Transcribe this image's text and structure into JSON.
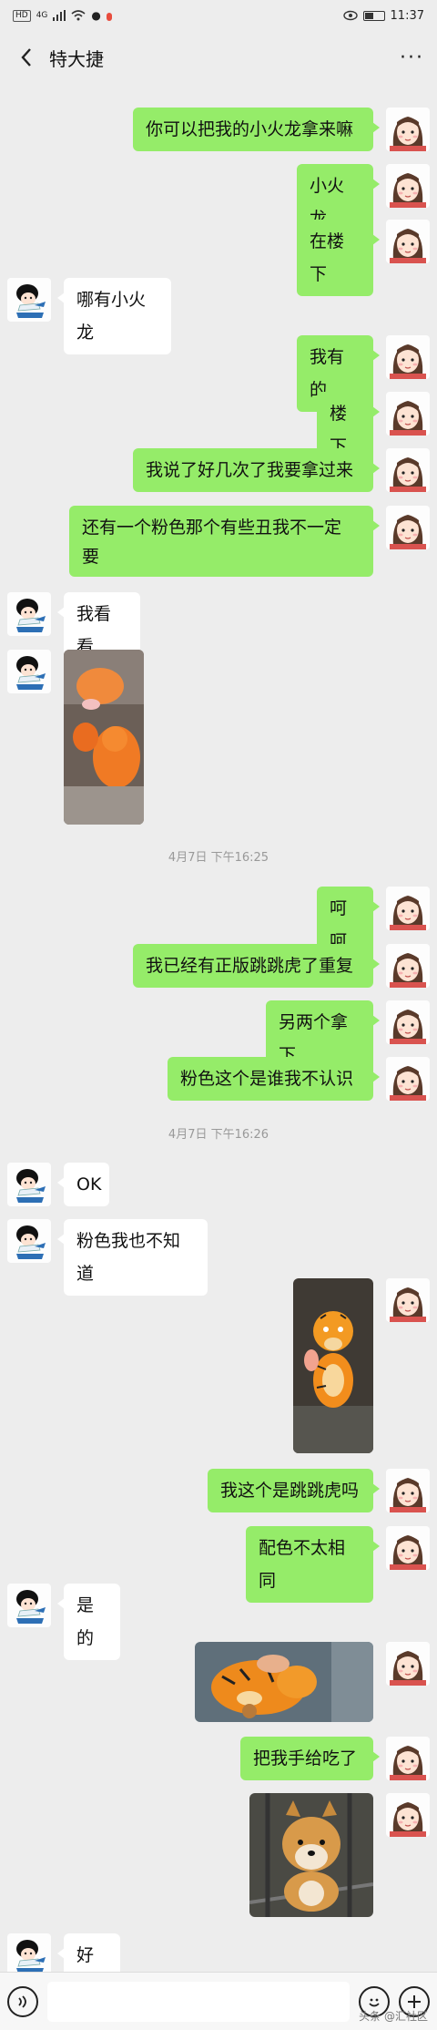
{
  "status_bar": {
    "left_tags": [
      "HD",
      "4G"
    ],
    "notification_badge": "",
    "time": "11:37"
  },
  "chat": {
    "title": "特大捷"
  },
  "messages": [
    {
      "side": "me",
      "text": "你可以把我的小火龙拿来嘛"
    },
    {
      "side": "me",
      "text": "小火龙"
    },
    {
      "side": "me",
      "text": "在楼下"
    },
    {
      "side": "other",
      "text": "哪有小火龙"
    },
    {
      "side": "me",
      "text": "我有的"
    },
    {
      "side": "me",
      "text": "楼下"
    },
    {
      "side": "me",
      "text": "我说了好几次了我要拿过来"
    },
    {
      "side": "me",
      "text_line1": "还有一个粉色那个有些丑我不一定",
      "text_line2": "要"
    },
    {
      "side": "other",
      "text": "我看看"
    },
    {
      "side": "other",
      "image": "photo of orange plush toys (charmander and tigger)"
    },
    {
      "type": "timestamp",
      "text": "4月7日 下午16:25"
    },
    {
      "side": "me",
      "text": "呵呵"
    },
    {
      "side": "me",
      "text": "我已经有正版跳跳虎了重复"
    },
    {
      "side": "me",
      "text": "另两个拿下"
    },
    {
      "side": "me",
      "text": "粉色这个是谁我不认识"
    },
    {
      "type": "timestamp",
      "text": "4月7日 下午16:26"
    },
    {
      "side": "other",
      "text": "OK"
    },
    {
      "side": "other",
      "text": "粉色我也不知道"
    },
    {
      "side": "me",
      "image": "photo of tigger plush toy"
    },
    {
      "side": "me",
      "text": "我这个是跳跳虎吗"
    },
    {
      "side": "me",
      "text": "配色不太相同"
    },
    {
      "side": "other",
      "text": "是的"
    },
    {
      "side": "me",
      "image": "photo of tigger plush lying down"
    },
    {
      "side": "me",
      "text": "把我手给吃了"
    },
    {
      "side": "me",
      "image": "photo of a shiba inu dog"
    },
    {
      "side": "other",
      "text": "好的"
    }
  ],
  "input_bar": {
    "voice_icon": "voice-icon",
    "emoji_icon": "emoji-icon",
    "plus_icon": "plus-icon"
  },
  "watermark": "头条 @汇社区",
  "colors": {
    "me_bubble": "#95ec69",
    "other_bubble": "#ffffff",
    "background": "#ededed"
  },
  "battery_level": 0.5
}
